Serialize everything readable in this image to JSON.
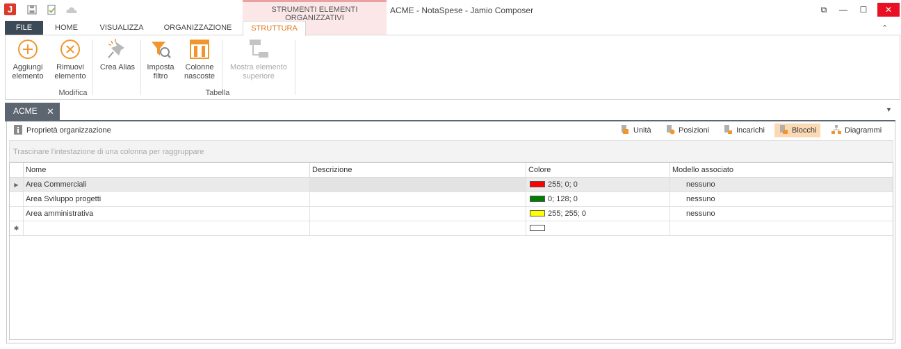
{
  "titlebar": {
    "app_logo": "J",
    "context_header": "STRUMENTI ELEMENTI ORGANIZZATIVI",
    "window_title": "ACME - NotaSpese - Jamio Composer",
    "qat_icons": [
      "save-icon",
      "check-document-icon",
      "cloud-icon"
    ],
    "controls": {
      "restore": "⧉",
      "minimize": "—",
      "maximize": "☐",
      "close": "✕"
    }
  },
  "ribbon": {
    "tabs": [
      {
        "label": "FILE"
      },
      {
        "label": "HOME"
      },
      {
        "label": "VISUALIZZA"
      },
      {
        "label": "ORGANIZZAZIONE"
      },
      {
        "label": "STRUTTURA"
      }
    ],
    "collapse_glyph": "⌃",
    "buttons": {
      "add": {
        "line1": "Aggiungi",
        "line2": "elemento"
      },
      "remove": {
        "line1": "Rimuovi",
        "line2": "elemento"
      },
      "alias": {
        "line1": "Crea Alias"
      },
      "filter": {
        "line1": "Imposta",
        "line2": "filtro"
      },
      "hidden_columns": {
        "line1": "Colonne",
        "line2": "nascoste"
      },
      "show_parent": {
        "line1": "Mostra elemento",
        "line2": "superiore"
      }
    },
    "groups": {
      "modifica": "Modifica",
      "tabella": "Tabella"
    }
  },
  "document_tab": {
    "label": "ACME",
    "close": "✕",
    "dropdown": "▼"
  },
  "panel": {
    "properties_label": "Proprietà organizzazione",
    "toolbar": {
      "unita": "Unità",
      "posizioni": "Posizioni",
      "incarichi": "Incarichi",
      "blocchi": "Blocchi",
      "diagrammi": "Diagrammi"
    },
    "group_hint": "Trascinare l'intestazione di una colonna per raggruppare"
  },
  "grid": {
    "columns": [
      "Nome",
      "Descrizione",
      "Colore",
      "Modello associato"
    ],
    "rows": [
      {
        "nome": "Area Commerciali",
        "descrizione": "",
        "colore": "255; 0; 0",
        "swatch": "#ff0000",
        "modello": "nessuno",
        "indicator": "▶"
      },
      {
        "nome": "Area Sviluppo progetti",
        "descrizione": "",
        "colore": "0; 128; 0",
        "swatch": "#008000",
        "modello": "nessuno",
        "indicator": ""
      },
      {
        "nome": "Area amministrativa",
        "descrizione": "",
        "colore": "255; 255; 0",
        "swatch": "#ffff00",
        "modello": "nessuno",
        "indicator": ""
      }
    ],
    "new_row": {
      "indicator": "✱",
      "swatch": "#ffffff"
    }
  }
}
